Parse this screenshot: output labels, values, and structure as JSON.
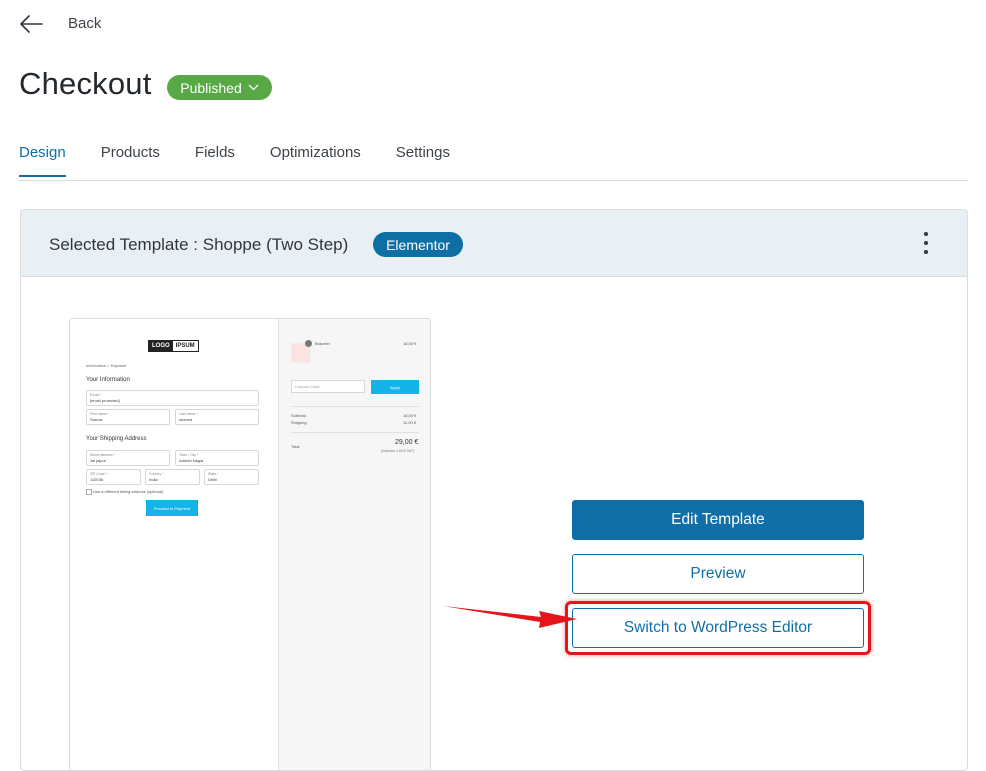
{
  "nav": {
    "back_label": "Back"
  },
  "page": {
    "title": "Checkout",
    "status": "Published"
  },
  "tabs": [
    {
      "label": "Design",
      "active": true
    },
    {
      "label": "Products",
      "active": false
    },
    {
      "label": "Fields",
      "active": false
    },
    {
      "label": "Optimizations",
      "active": false
    },
    {
      "label": "Settings",
      "active": false
    }
  ],
  "template_card": {
    "prefix": "Selected Template :",
    "name": "Shoppe",
    "variant": "(Two Step)",
    "builder_badge": "Elementor"
  },
  "actions": {
    "edit_label": "Edit Template",
    "preview_label": "Preview",
    "switch_label": "Switch to WordPress Editor"
  },
  "thumbnail": {
    "logo_a": "LOGO",
    "logo_b": "IPSUM",
    "crumb": "Information  >  Payment",
    "your_info": "Your Information",
    "email_label": "Email *",
    "email_value": "[email protected]",
    "first_label": "First name *",
    "first_value": "Saurav",
    "last_label": "Last name *",
    "last_value": "sharma",
    "shipping_heading": "Your Shipping Address",
    "street_label": "Street address *",
    "street_value": "Jai jaipur",
    "town_label": "Town / City *",
    "town_value": "Adarsh Nagar",
    "zip_label": "ZIP Code *",
    "zip_value": "110036",
    "country_label": "Country *",
    "country_value": "India",
    "state_label": "State *",
    "state_value": "Delhi",
    "billing_check": "Use a different billing address (optional)",
    "proceed_btn": "Proceed to Payment",
    "product_name": "Bracelet",
    "product_price": "18,00 €",
    "coupon_placeholder": "Coupon Code",
    "apply_btn": "Apply",
    "subtotal_label": "Subtotal",
    "subtotal_value": "18,00 €",
    "shipping_label": "Shipping",
    "shipping_value": "11,00 €",
    "total_label": "Total",
    "total_value": "29,00 €",
    "total_note": "(includes 2,64 € VAT)"
  },
  "colors": {
    "accent": "#0f6fa6",
    "published": "#58a845",
    "highlight": "#e4151b"
  }
}
